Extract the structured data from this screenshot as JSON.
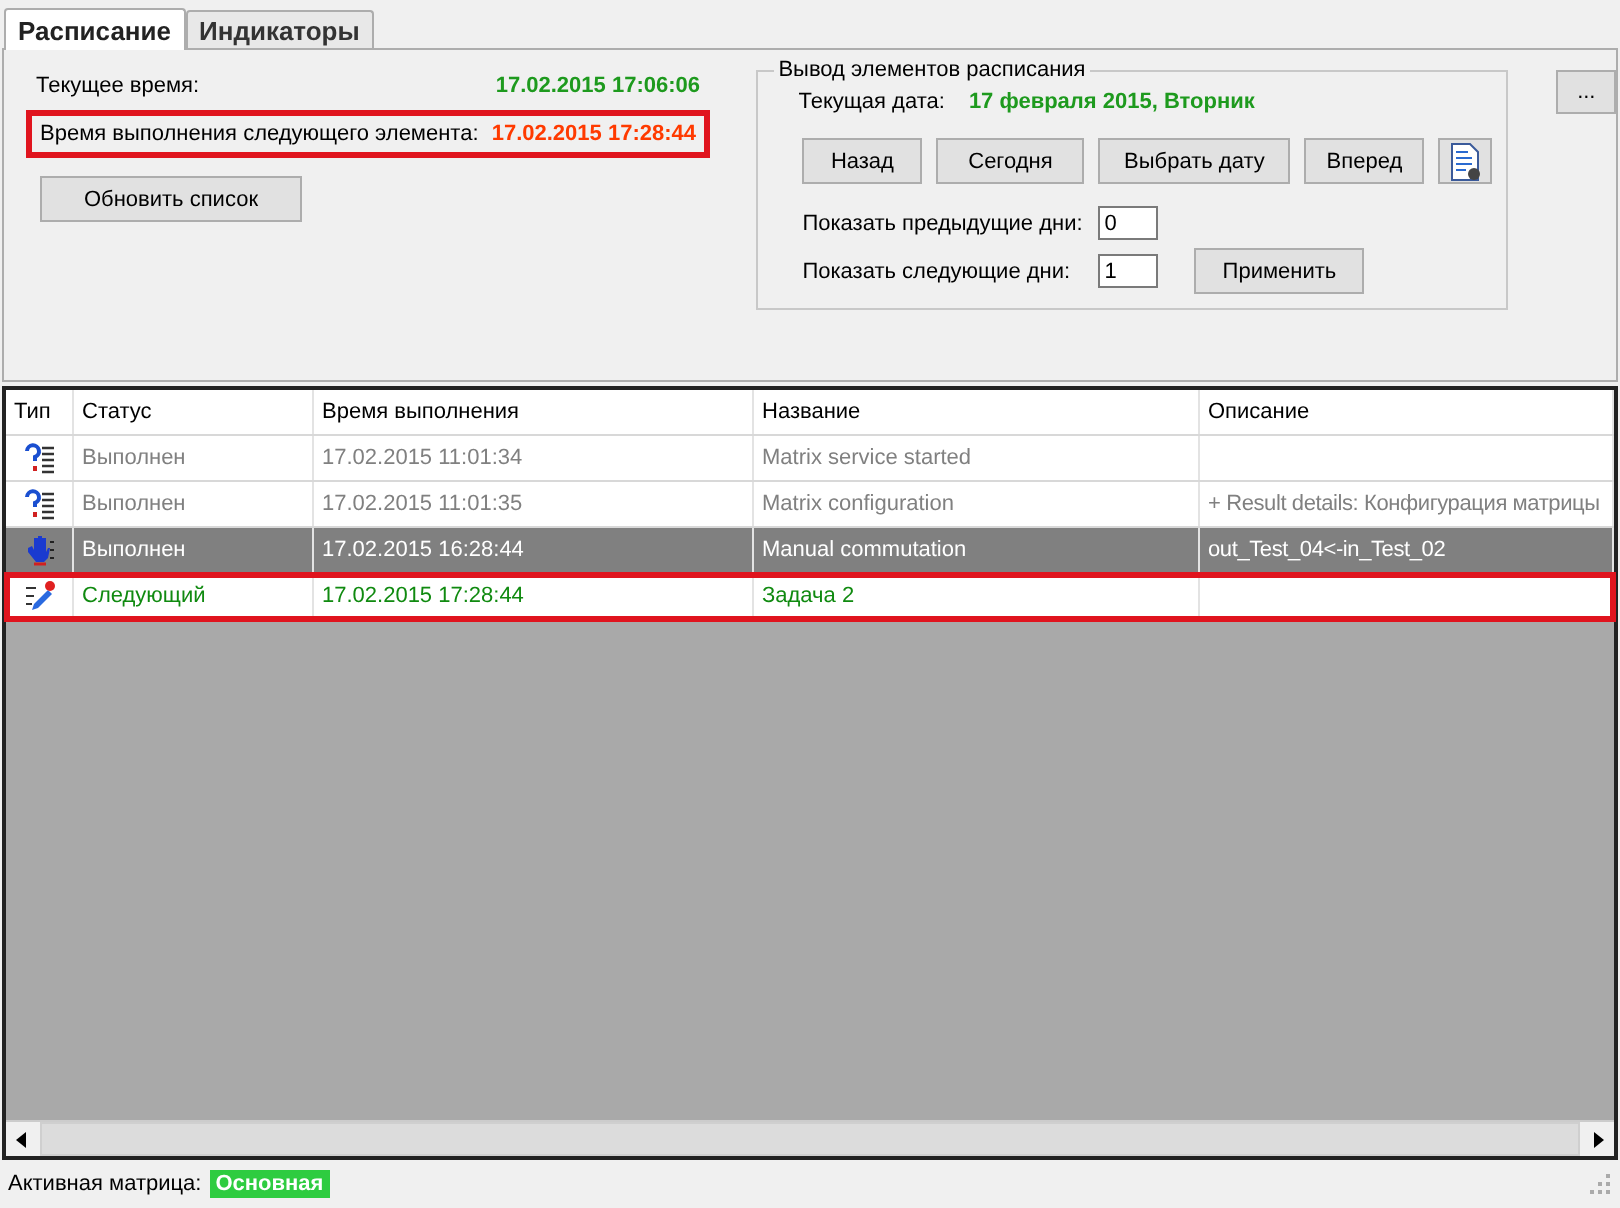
{
  "tabs": [
    {
      "label": "Расписание",
      "selected": true
    },
    {
      "label": "Индикаторы",
      "selected": false
    }
  ],
  "current_time": {
    "label": "Текущее время:",
    "value": "17.02.2015 17:06:06"
  },
  "next_time": {
    "label": "Время выполнения следующего элемента:",
    "value": "17.02.2015 17:28:44",
    "highlighted": true
  },
  "refresh_button": "Обновить список",
  "more_button": "...",
  "output_group": {
    "title": "Вывод элементов расписания",
    "date_label": "Текущая дата:",
    "date_value": "17 февраля 2015, Вторник",
    "nav_buttons": [
      "Назад",
      "Сегодня",
      "Выбрать дату",
      "Вперед"
    ],
    "prev_days": {
      "label": "Показать предыдущие дни:",
      "value": "0"
    },
    "next_days": {
      "label": "Показать следующие дни:",
      "value": "1"
    },
    "apply_button": "Применить"
  },
  "table": {
    "columns": [
      "Тип",
      "Статус",
      "Время выполнения",
      "Название",
      "Описание"
    ],
    "rows": [
      {
        "kind": "question",
        "next": false,
        "selected": false,
        "status": "Выполнен",
        "time": "17.02.2015 11:01:34",
        "name": "Matrix service started",
        "description": ""
      },
      {
        "kind": "question",
        "next": false,
        "selected": false,
        "status": "Выполнен",
        "time": "17.02.2015 11:01:35",
        "name": "Matrix configuration",
        "description": "+ Result details: Конфигурация матрицы"
      },
      {
        "kind": "manual",
        "next": false,
        "selected": true,
        "status": "Выполнен",
        "time": "17.02.2015 16:28:44",
        "name": "Manual commutation",
        "description": "out_Test_04<-in_Test_02"
      },
      {
        "kind": "task",
        "next": true,
        "selected": false,
        "status": "Следующий",
        "time": "17.02.2015 17:28:44",
        "name": "Задача 2",
        "description": ""
      }
    ]
  },
  "status_bar": {
    "label": "Активная матрица:",
    "value": "Основная"
  }
}
